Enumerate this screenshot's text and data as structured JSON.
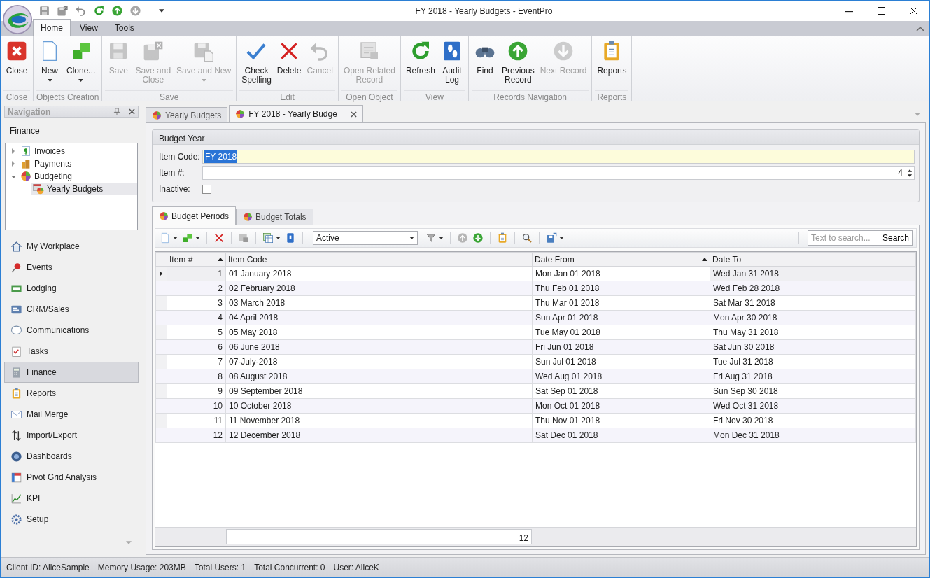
{
  "window": {
    "title": "FY 2018 - Yearly Budgets - EventPro"
  },
  "ribbon_tabs": [
    {
      "label": "Home",
      "selected": true
    },
    {
      "label": "View",
      "selected": false
    },
    {
      "label": "Tools",
      "selected": false
    }
  ],
  "ribbon_groups": [
    {
      "label": "Close",
      "buttons": [
        {
          "label": "Close",
          "disabled": false,
          "dropdown": false
        }
      ]
    },
    {
      "label": "Objects Creation",
      "buttons": [
        {
          "label": "New",
          "disabled": false,
          "dropdown": true
        },
        {
          "label": "Clone...",
          "disabled": false,
          "dropdown": true
        }
      ]
    },
    {
      "label": "Save",
      "buttons": [
        {
          "label": "Save",
          "disabled": true,
          "dropdown": false
        },
        {
          "label": "Save and\nClose",
          "disabled": true,
          "dropdown": false
        },
        {
          "label": "Save and New",
          "disabled": true,
          "dropdown": true
        }
      ]
    },
    {
      "label": "Edit",
      "buttons": [
        {
          "label": "Check\nSpelling",
          "disabled": false,
          "dropdown": false
        },
        {
          "label": "Delete",
          "disabled": false,
          "dropdown": false
        },
        {
          "label": "Cancel",
          "disabled": true,
          "dropdown": false
        }
      ]
    },
    {
      "label": "Open Object",
      "buttons": [
        {
          "label": "Open Related\nRecord",
          "disabled": true,
          "dropdown": false
        }
      ]
    },
    {
      "label": "View",
      "buttons": [
        {
          "label": "Refresh",
          "disabled": false,
          "dropdown": false
        },
        {
          "label": "Audit\nLog",
          "disabled": false,
          "dropdown": false
        }
      ]
    },
    {
      "label": "Records Navigation",
      "buttons": [
        {
          "label": "Find",
          "disabled": false,
          "dropdown": false
        },
        {
          "label": "Previous\nRecord",
          "disabled": false,
          "dropdown": false
        },
        {
          "label": "Next Record",
          "disabled": true,
          "dropdown": false
        }
      ]
    },
    {
      "label": "Reports",
      "buttons": [
        {
          "label": "Reports",
          "disabled": false,
          "dropdown": false
        }
      ]
    }
  ],
  "navigation": {
    "title": "Navigation",
    "section": "Finance",
    "tree": [
      {
        "label": "Invoices",
        "expanded": false,
        "selected": false
      },
      {
        "label": "Payments",
        "expanded": false,
        "selected": false
      },
      {
        "label": "Budgeting",
        "expanded": true,
        "selected": false,
        "children": [
          {
            "label": "Yearly Budgets",
            "selected": true
          }
        ]
      }
    ],
    "modules": [
      {
        "label": "My Workplace",
        "selected": false
      },
      {
        "label": "Events",
        "selected": false
      },
      {
        "label": "Lodging",
        "selected": false
      },
      {
        "label": "CRM/Sales",
        "selected": false
      },
      {
        "label": "Communications",
        "selected": false
      },
      {
        "label": "Tasks",
        "selected": false
      },
      {
        "label": "Finance",
        "selected": true
      },
      {
        "label": "Reports",
        "selected": false
      },
      {
        "label": "Mail Merge",
        "selected": false
      },
      {
        "label": "Import/Export",
        "selected": false
      },
      {
        "label": "Dashboards",
        "selected": false
      },
      {
        "label": "Pivot Grid Analysis",
        "selected": false
      },
      {
        "label": "KPI",
        "selected": false
      },
      {
        "label": "Setup",
        "selected": false
      }
    ]
  },
  "document_tabs": [
    {
      "label": "Yearly Budgets",
      "selected": false
    },
    {
      "label": "FY 2018 - Yearly Budge",
      "selected": true
    }
  ],
  "budget_year": {
    "title": "Budget Year",
    "item_code": {
      "label": "Item Code:",
      "value": "FY 2018"
    },
    "item_number": {
      "label": "Item #:",
      "value": "4"
    },
    "inactive": {
      "label": "Inactive:",
      "checked": false
    }
  },
  "detail_tabs": [
    {
      "label": "Budget Periods",
      "selected": true
    },
    {
      "label": "Budget Totals",
      "selected": false
    }
  ],
  "grid": {
    "filter": {
      "value": "Active"
    },
    "search": {
      "placeholder": "Text to search...",
      "button": "Search"
    },
    "columns": [
      {
        "label": "Item #",
        "sorted": true
      },
      {
        "label": "Item Code",
        "sorted": false
      },
      {
        "label": "Date From",
        "sorted": true
      },
      {
        "label": "Date To",
        "sorted": false
      }
    ],
    "rows": [
      {
        "selected": true,
        "cells": [
          "1",
          "01 January 2018",
          "Mon Jan 01 2018",
          "Wed Jan 31 2018"
        ]
      },
      {
        "selected": false,
        "cells": [
          "2",
          "02 February 2018",
          "Thu Feb 01 2018",
          "Wed Feb 28 2018"
        ]
      },
      {
        "selected": false,
        "cells": [
          "3",
          "03 March 2018",
          "Thu Mar 01 2018",
          "Sat Mar 31 2018"
        ]
      },
      {
        "selected": false,
        "cells": [
          "4",
          "04 April 2018",
          "Sun Apr 01 2018",
          "Mon Apr 30 2018"
        ]
      },
      {
        "selected": false,
        "cells": [
          "5",
          "05 May 2018",
          "Tue May 01 2018",
          "Thu May 31 2018"
        ]
      },
      {
        "selected": false,
        "cells": [
          "6",
          "06 June 2018",
          "Fri Jun 01 2018",
          "Sat Jun 30 2018"
        ]
      },
      {
        "selected": false,
        "cells": [
          "7",
          "07-July-2018",
          "Sun Jul 01 2018",
          "Tue Jul 31 2018"
        ]
      },
      {
        "selected": false,
        "cells": [
          "8",
          "08 August 2018",
          "Wed Aug 01 2018",
          "Fri Aug 31 2018"
        ]
      },
      {
        "selected": false,
        "cells": [
          "9",
          "09 September 2018",
          "Sat Sep 01 2018",
          "Sun Sep 30 2018"
        ]
      },
      {
        "selected": false,
        "cells": [
          "10",
          "10 October 2018",
          "Mon Oct 01 2018",
          "Wed Oct 31 2018"
        ]
      },
      {
        "selected": false,
        "cells": [
          "11",
          "11 November 2018",
          "Thu Nov 01 2018",
          "Fri Nov 30 2018"
        ]
      },
      {
        "selected": false,
        "cells": [
          "12",
          "12 December 2018",
          "Sat Dec 01 2018",
          "Mon Dec 31 2018"
        ]
      }
    ],
    "footer": {
      "count": "12"
    }
  },
  "status_bar": [
    "Client ID: AliceSample",
    "Memory Usage: 203MB",
    "Total Users: 1",
    "Total Concurrent: 0",
    "User: AliceK"
  ]
}
